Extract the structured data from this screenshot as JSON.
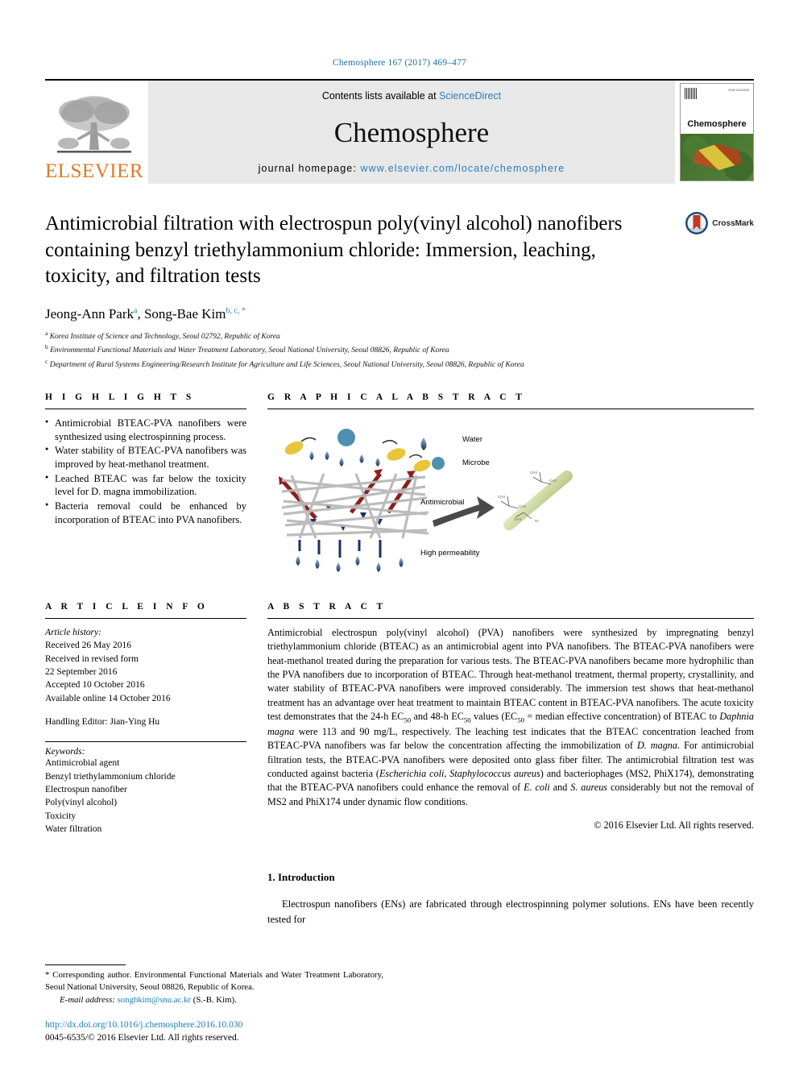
{
  "running_head": "Chemosphere 167 (2017) 469–477",
  "banner": {
    "publisher": "ELSEVIER",
    "contents_prefix": "Contents lists available at ",
    "contents_link": "ScienceDirect",
    "journal_title": "Chemosphere",
    "homepage_prefix": "journal homepage: ",
    "homepage_url": "www.elsevier.com/locate/chemosphere",
    "cover_title": "Chemosphere"
  },
  "article": {
    "title": "Antimicrobial filtration with electrospun poly(vinyl alcohol) nanofibers containing benzyl triethylammonium chloride: Immersion, leaching, toxicity, and filtration tests",
    "crossmark_label": "CrossMark",
    "authors_plain": "Jeong-Ann Park a, Song-Bae Kim b, c, *",
    "authors": [
      {
        "name": "Jeong-Ann Park",
        "marks": "a"
      },
      {
        "name": "Song-Bae Kim",
        "marks": "b, c, *"
      }
    ],
    "affiliations": [
      {
        "mark": "a",
        "text": "Korea Institute of Science and Technology, Seoul 02792, Republic of Korea"
      },
      {
        "mark": "b",
        "text": "Environmental Functional Materials and Water Treatment Laboratory, Seoul National University, Seoul 08826, Republic of Korea"
      },
      {
        "mark": "c",
        "text": "Department of Rural Systems Engineering/Research Institute for Agriculture and Life Sciences, Seoul National University, Seoul 08826, Republic of Korea"
      }
    ]
  },
  "highlights": {
    "heading": "H I G H L I G H T S",
    "items": [
      "Antimicrobial BTEAC-PVA nanofibers were synthesized using electrospinning process.",
      "Water stability of BTEAC-PVA nanofibers was improved by heat-methanol treatment.",
      "Leached BTEAC was far below the toxicity level for D. magna immobilization.",
      "Bacteria removal could be enhanced by incorporation of BTEAC into PVA nanofibers."
    ]
  },
  "graphical_abstract": {
    "heading": "G R A P H I C A L   A B S T R A C T",
    "labels": {
      "water": "Water",
      "microbe": "Microbe",
      "antimicrobial": "Antimicrobial",
      "permeability": "High permeability"
    }
  },
  "article_info": {
    "heading": "A R T I C L E   I N F O",
    "history_label": "Article history:",
    "history_lines": [
      "Received 26 May 2016",
      "Received in revised form",
      "22 September 2016",
      "Accepted 10 October 2016",
      "Available online 14 October 2016"
    ],
    "handling_editor": "Handling Editor: Jian-Ying Hu",
    "keywords_label": "Keywords:",
    "keywords": [
      "Antimicrobial agent",
      "Benzyl triethylammonium chloride",
      "Electrospun nanofiber",
      "Poly(vinyl alcohol)",
      "Toxicity",
      "Water filtration"
    ]
  },
  "abstract": {
    "heading": "A B S T R A C T",
    "paragraph_1": "Antimicrobial electrospun poly(vinyl alcohol) (PVA) nanofibers were synthesized by impregnating benzyl triethylammonium chloride (BTEAC) as an antimicrobial agent into PVA nanofibers. The BTEAC-PVA nanofibers were heat-methanol treated during the preparation for various tests. The BTEAC-PVA nanofibers became more hydrophilic than the PVA nanofibers due to incorporation of BTEAC. Through heat-methanol treatment, thermal property, crystallinity, and water stability of BTEAC-PVA nanofibers were improved considerably. The immersion test shows that heat-methanol treatment has an advantage over heat treatment to maintain BTEAC content in BTEAC-PVA nanofibers. The acute toxicity test demonstrates that the 24-h EC",
    "ec_sub": "50",
    "paragraph_2": " and 48-h EC",
    "paragraph_3": " values (EC",
    "paragraph_4": " = median effective concentration) of BTEAC to ",
    "daphnia": "Daphnia magna",
    "paragraph_5": " were 113 and 90 mg/L, respectively. The leaching test indicates that the BTEAC concentration leached from BTEAC-PVA nanofibers was far below the concentration affecting the immobilization of ",
    "dmagna": "D. magna",
    "paragraph_6": ". For antimicrobial filtration tests, the BTEAC-PVA nanofibers were deposited onto glass fiber filter. The antimicrobial filtration test was conducted against bacteria (",
    "ecoli_it": "Escherichia coli, Staphylococcus aureus",
    "paragraph_7": ") and bacteriophages (MS2, PhiX174), demonstrating that the BTEAC-PVA nanofibers could enhance the removal of ",
    "ecoli_short": "E. coli",
    "paragraph_8": " and ",
    "saureus_short": "S. aureus",
    "paragraph_9": " considerably but not the removal of MS2 and PhiX174 under dynamic flow conditions.",
    "copyright": "© 2016 Elsevier Ltd. All rights reserved."
  },
  "introduction": {
    "heading": "1. Introduction",
    "paragraph": "Electrospun nanofibers (ENs) are fabricated through electrospinning polymer solutions. ENs have been recently tested for"
  },
  "footer": {
    "corresponding_star": "*",
    "corresponding_text": " Corresponding author. Environmental Functional Materials and Water Treatment Laboratory, Seoul National University, Seoul 08826, Republic of Korea.",
    "email_label": "E-mail address:",
    "email": "songbkim@snu.ac.kr",
    "email_owner": " (S.-B. Kim).",
    "doi": "http://dx.doi.org/10.1016/j.chemosphere.2016.10.030",
    "issn_line": "0045-6535/© 2016 Elsevier Ltd. All rights reserved."
  },
  "colors": {
    "link": "#1a7fb5",
    "elsevier_orange": "#E87722",
    "banner_bg": "#e8e8e8"
  }
}
